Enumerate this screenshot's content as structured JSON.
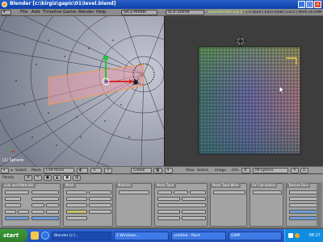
{
  "window": {
    "title": "Blender [c:\\kirgiz\\gapic\\01\\level.blend]"
  },
  "menubar": {
    "items": [
      "File",
      "Add",
      "Timeline",
      "Game",
      "Render",
      "Help"
    ],
    "screen": "SR:2-Model",
    "scene": "SCE:Scene",
    "url": "www.blender.org 248.1",
    "stats": "Fa:0-1024 | Ed:0-2048 | La:0 | Mem:16.49M (0.31M)"
  },
  "viewport3d": {
    "object_label": "(1) Sphere",
    "header": {
      "view_menu": "Select",
      "mesh_menu": "Mesh",
      "mode": "Edit Mode",
      "orientation": "Global"
    }
  },
  "uv_editor": {
    "header": {
      "view_menu": "View",
      "select_menu": "Select",
      "image_menu": "Image",
      "uvs_menu": "UVs",
      "image_name": "IM:Sphere"
    }
  },
  "buttons_window": {
    "header": {
      "panels_label": "Panels"
    },
    "panels": [
      {
        "tab": "Link and Materials"
      },
      {
        "tab": "Mesh"
      },
      {
        "tab": "Multires"
      },
      {
        "tab": "Mesh Tools"
      },
      {
        "tab": "Mesh Tools More"
      },
      {
        "tab": "UV Calculation"
      },
      {
        "tab": "Texture Face"
      }
    ]
  },
  "taskbar": {
    "start_label": "start",
    "buttons": [
      "Blender [c:\\...",
      "2 Windows...",
      "untitled - Paint",
      "GIMP"
    ],
    "clock": "08:27"
  },
  "colors": {
    "titlebar": "#0a3fa8",
    "uv_grid_bg": "#3d3d3d",
    "selected": "#ff9a30",
    "taskbar": "#1d4fb8"
  }
}
